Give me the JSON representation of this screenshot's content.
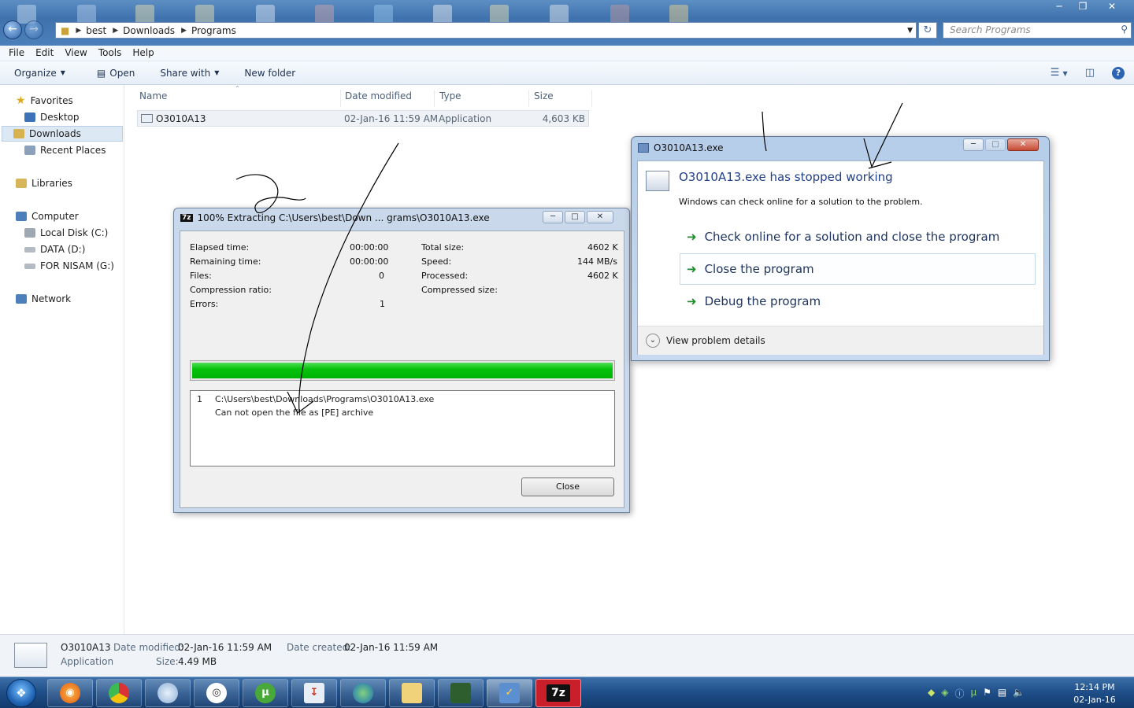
{
  "explorer": {
    "breadcrumbs": [
      "best",
      "Downloads",
      "Programs"
    ],
    "search_placeholder": "Search Programs",
    "menu": [
      "File",
      "Edit",
      "View",
      "Tools",
      "Help"
    ],
    "commands": {
      "organize": "Organize",
      "open": "Open",
      "share_with": "Share with",
      "new_folder": "New folder"
    },
    "nav": {
      "favorites": "Favorites",
      "desktop": "Desktop",
      "downloads": "Downloads",
      "recent": "Recent Places",
      "libraries": "Libraries",
      "computer": "Computer",
      "local_disk": "Local Disk (C:)",
      "data": "DATA (D:)",
      "nisam": "FOR NISAM (G:)",
      "network": "Network"
    },
    "columns": {
      "name": "Name",
      "date": "Date modified",
      "type": "Type",
      "size": "Size"
    },
    "file": {
      "name": "O3010A13",
      "date": "02-Jan-16 11:59 AM",
      "type": "Application",
      "size": "4,603 KB"
    },
    "details": {
      "name": "O3010A13",
      "type": "Application",
      "date_modified_label": "Date modified:",
      "date_modified": "02-Jan-16 11:59 AM",
      "size_label": "Size:",
      "size": "4.49 MB",
      "date_created_label": "Date created:",
      "date_created": "02-Jan-16 11:59 AM"
    }
  },
  "extract_dialog": {
    "title": "100% Extracting C:\\Users\\best\\Down ... grams\\O3010A13.exe",
    "icon_text": "7z",
    "elapsed_label": "Elapsed time:",
    "elapsed": "00:00:00",
    "remaining_label": "Remaining time:",
    "remaining": "00:00:00",
    "files_label": "Files:",
    "files": "0",
    "ratio_label": "Compression ratio:",
    "errors_label": "Errors:",
    "errors": "1",
    "total_label": "Total size:",
    "total": "4602 K",
    "speed_label": "Speed:",
    "speed": "144 MB/s",
    "processed_label": "Processed:",
    "processed": "4602 K",
    "compressed_label": "Compressed size:",
    "progress": 1.0,
    "error_index": "1",
    "error_path": "C:\\Users\\best\\Downloads\\Programs\\O3010A13.exe",
    "error_message": "Can not open the file as [PE] archive",
    "close_label": "Close"
  },
  "crash_dialog": {
    "title": "O3010A13.exe",
    "heading": "O3010A13.exe has stopped working",
    "subtext": "Windows can check online for a solution to the problem.",
    "options": [
      "Check online for a solution and close the program",
      "Close the program",
      "Debug the program"
    ],
    "details_label": "View problem details"
  },
  "taskbar": {
    "clock_time": "12:14 PM",
    "clock_date": "02-Jan-16",
    "sevenzip_label": "7z"
  },
  "colors": {
    "progress": "#06c20c",
    "link": "#1f3f8c",
    "arrow": "#1d8d2a"
  }
}
